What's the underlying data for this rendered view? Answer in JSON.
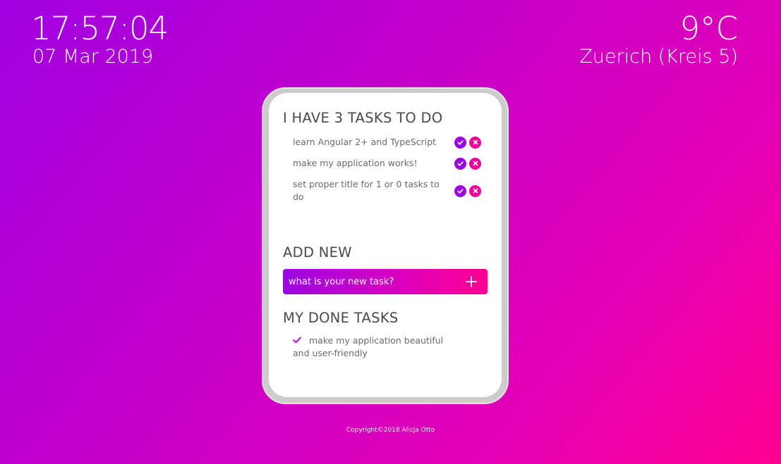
{
  "clock": {
    "time": "17:57:04",
    "date": "07 Mar 2019"
  },
  "weather": {
    "temperature": "9°C",
    "location": "Zuerich (Kreis 5)"
  },
  "todo": {
    "heading": "I HAVE 3 TASKS TO DO",
    "items": [
      {
        "text": "learn Angular 2+ and TypeScript"
      },
      {
        "text": "make my application works!"
      },
      {
        "text": "set proper title for 1 or 0 tasks to do"
      }
    ],
    "check_icon": "check-circle-icon",
    "delete_icon": "x-circle-icon"
  },
  "add_new": {
    "heading": "ADD NEW",
    "placeholder": "what is your new task?",
    "button_icon": "plus-icon"
  },
  "done": {
    "heading": "MY DONE TASKS",
    "items": [
      {
        "text": "make my application beautiful and user-friendly"
      }
    ],
    "done_icon": "check-icon"
  },
  "footer": {
    "copyright": "Copyright©2018 Alicja Otto"
  },
  "colors": {
    "accent_purple": "#9b06e0",
    "accent_pink": "#f2009c",
    "background_start": "#a000e0",
    "background_end": "#ff0090"
  }
}
